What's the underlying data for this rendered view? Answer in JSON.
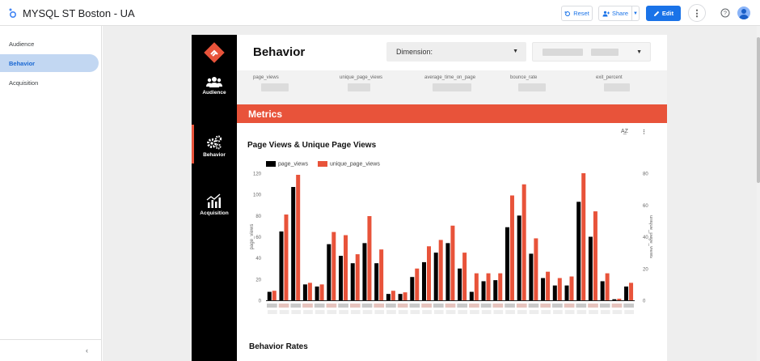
{
  "app": {
    "title": "MYSQL ST Boston - UA",
    "reset_label": "Reset",
    "share_label": "Share",
    "edit_label": "Edit"
  },
  "left_nav": {
    "items": [
      {
        "label": "Audience",
        "active": false
      },
      {
        "label": "Behavior",
        "active": true
      },
      {
        "label": "Acquisition",
        "active": false
      }
    ]
  },
  "report": {
    "sidebar": {
      "items": [
        {
          "label": "Audience",
          "icon": "people-icon"
        },
        {
          "label": "Behavior",
          "icon": "gears-icon"
        },
        {
          "label": "Acquisition",
          "icon": "growth-chart-icon"
        }
      ]
    },
    "title": "Behavior",
    "dimension_label": "Dimension:",
    "kpis": [
      "page_views",
      "unique_page_views",
      "average_time_on_page",
      "bounce_rate",
      "exit_percent"
    ],
    "metrics_header": "Metrics",
    "sort_label": "A͢Z",
    "section2_title": "Behavior Rates"
  },
  "colors": {
    "accent": "#e8533a",
    "primary_blue": "#1a73e8",
    "series1": "#000000",
    "series2": "#e8533a"
  },
  "chart_data": {
    "type": "bar",
    "title": "Page Views & Unique Page Views",
    "ylabel": "page_views",
    "y2label": "unique_page_views",
    "ylim": [
      0,
      120
    ],
    "y2lim": [
      0,
      80
    ],
    "yticks": [
      0,
      20,
      40,
      60,
      80,
      100,
      120
    ],
    "y2ticks": [
      0,
      20,
      40,
      60,
      80
    ],
    "series": [
      {
        "name": "page_views",
        "axis": "left",
        "values": [
          8,
          65,
          107,
          15,
          13,
          53,
          42,
          35,
          54,
          35,
          6,
          6,
          22,
          36,
          45,
          54,
          30,
          8,
          18,
          19,
          69,
          80,
          44,
          21,
          14,
          14,
          93,
          60,
          18,
          1,
          13
        ]
      },
      {
        "name": "unique_page_views",
        "axis": "right",
        "values": [
          6,
          54,
          79,
          11,
          10,
          43,
          41,
          29,
          53,
          32,
          6,
          5,
          20,
          34,
          38,
          47,
          30,
          17,
          17,
          17,
          66,
          73,
          39,
          18,
          14,
          15,
          80,
          56,
          17,
          1,
          11
        ]
      }
    ]
  }
}
